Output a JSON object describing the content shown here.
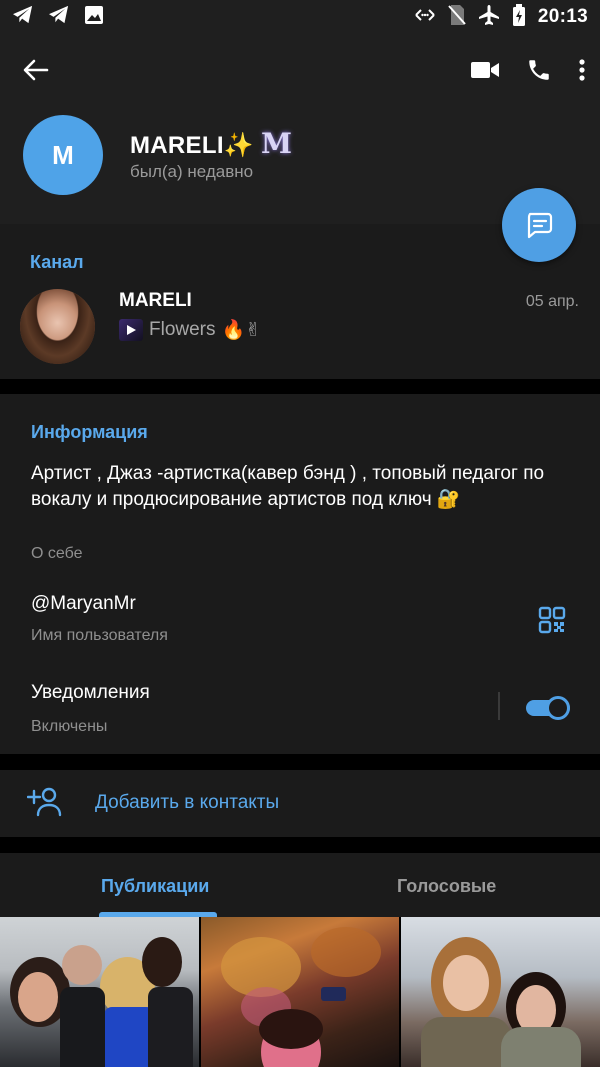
{
  "status_bar": {
    "time": "20:13",
    "left_icons": [
      "telegram-icon",
      "telegram-icon",
      "image-icon"
    ],
    "right_icons": [
      "data-arrows-icon",
      "no-sim-icon",
      "airplane-icon",
      "battery-icon"
    ]
  },
  "header": {
    "avatar_letter": "M",
    "name": "MARELI",
    "name_emoji": "✨",
    "name_monogram": "M",
    "status": "был(а) недавно",
    "icons": [
      "back-arrow-icon",
      "video-call-icon",
      "phone-icon",
      "more-vert-icon"
    ]
  },
  "channel": {
    "section_label": "Канал",
    "name": "MARELI",
    "date": "05 апр.",
    "last_message": "Flowers",
    "last_message_emoji": "🔥✌"
  },
  "info": {
    "section_label": "Информация",
    "about": "Артист , Джаз -артистка(кавер бэнд ) , топовый педагог по вокалу и продюсирование артистов под ключ",
    "about_emoji": "🔐",
    "about_caption": "О себе",
    "username": "@MaryanMr",
    "username_caption": "Имя пользователя",
    "notifications_title": "Уведомления",
    "notifications_caption": "Включены",
    "notifications_enabled": true
  },
  "add_contact": {
    "label": "Добавить в контакты"
  },
  "tabs": {
    "items": [
      {
        "label": "Публикации",
        "active": true
      },
      {
        "label": "Голосовые",
        "active": false
      }
    ]
  },
  "colors": {
    "accent": "#5aa9ec",
    "fab": "#4f9fe4",
    "background": "#1b1b1b",
    "header_bg": "#1f1f1f",
    "avatar": "#4fa3e8"
  }
}
